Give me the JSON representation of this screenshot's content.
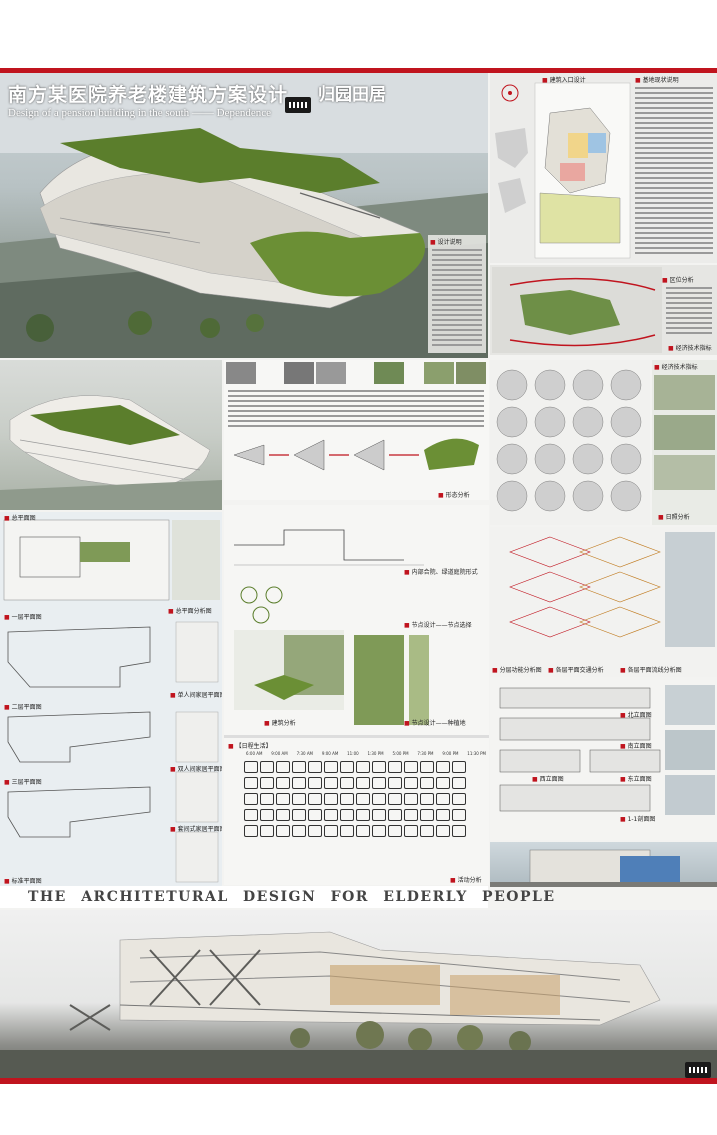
{
  "header": {
    "title_cn": "南方某医院养老楼建筑方案设计",
    "title_en": "Design of a pension building in the south  ——  Dependence",
    "subtitle_cn": "归园田居"
  },
  "sections": {
    "design_description": "设计说明",
    "site_entrance": "建筑入口设计",
    "site_overview": "基地现状说明",
    "region_analysis": "区位分析",
    "economic_indicators": "经济技术指标",
    "form_analysis": "形态分析",
    "sun_analysis": "日照分析",
    "site_plan": "总平面图",
    "first_floor_plan": "一层平面图",
    "second_floor_plan": "二层平面图",
    "third_floor_plan": "三层平面图",
    "typical_floor_plan": "标准平面图",
    "general_analysis": "总平面分析图",
    "single_room_plan": "单人间家居平面图",
    "double_room_plan": "双人间家居平面图",
    "suite_room_plan": "套间式家居平面图",
    "internal_space": "内部合院、绿道庭院形式",
    "node_design_1": "节点设计——节点选择",
    "node_design_2": "节点设计——种植地",
    "building_analysis": "建筑分析",
    "activity_analysis": "活动分析",
    "function_zoning": "分层功能分析图",
    "floor_traffic": "各层平面交通分析",
    "flow_analysis": "各层平面流线分析图",
    "north_elevation": "北立面图",
    "south_elevation": "南立面图",
    "west_elevation": "西立面图",
    "east_elevation": "东立面图",
    "section_1": "1-1剖面图",
    "daily_routine": "【日程生活】"
  },
  "schedule_times": [
    "6:00 AM",
    "9:00 AM",
    "7:30 AM",
    "9:00 AM",
    "11:00",
    "1:30 PM",
    "5:00 PM",
    "7:30 PM",
    "9:00 PM",
    "11:30 PM"
  ],
  "banner": {
    "text": "THE ARCHITETURAL DESIGN FOR ELDERLY PEOPLE"
  },
  "colors": {
    "accent_red": "#c0141e",
    "roof_green": "#5b7e2c",
    "poster_bg": "#f3f3f1"
  }
}
